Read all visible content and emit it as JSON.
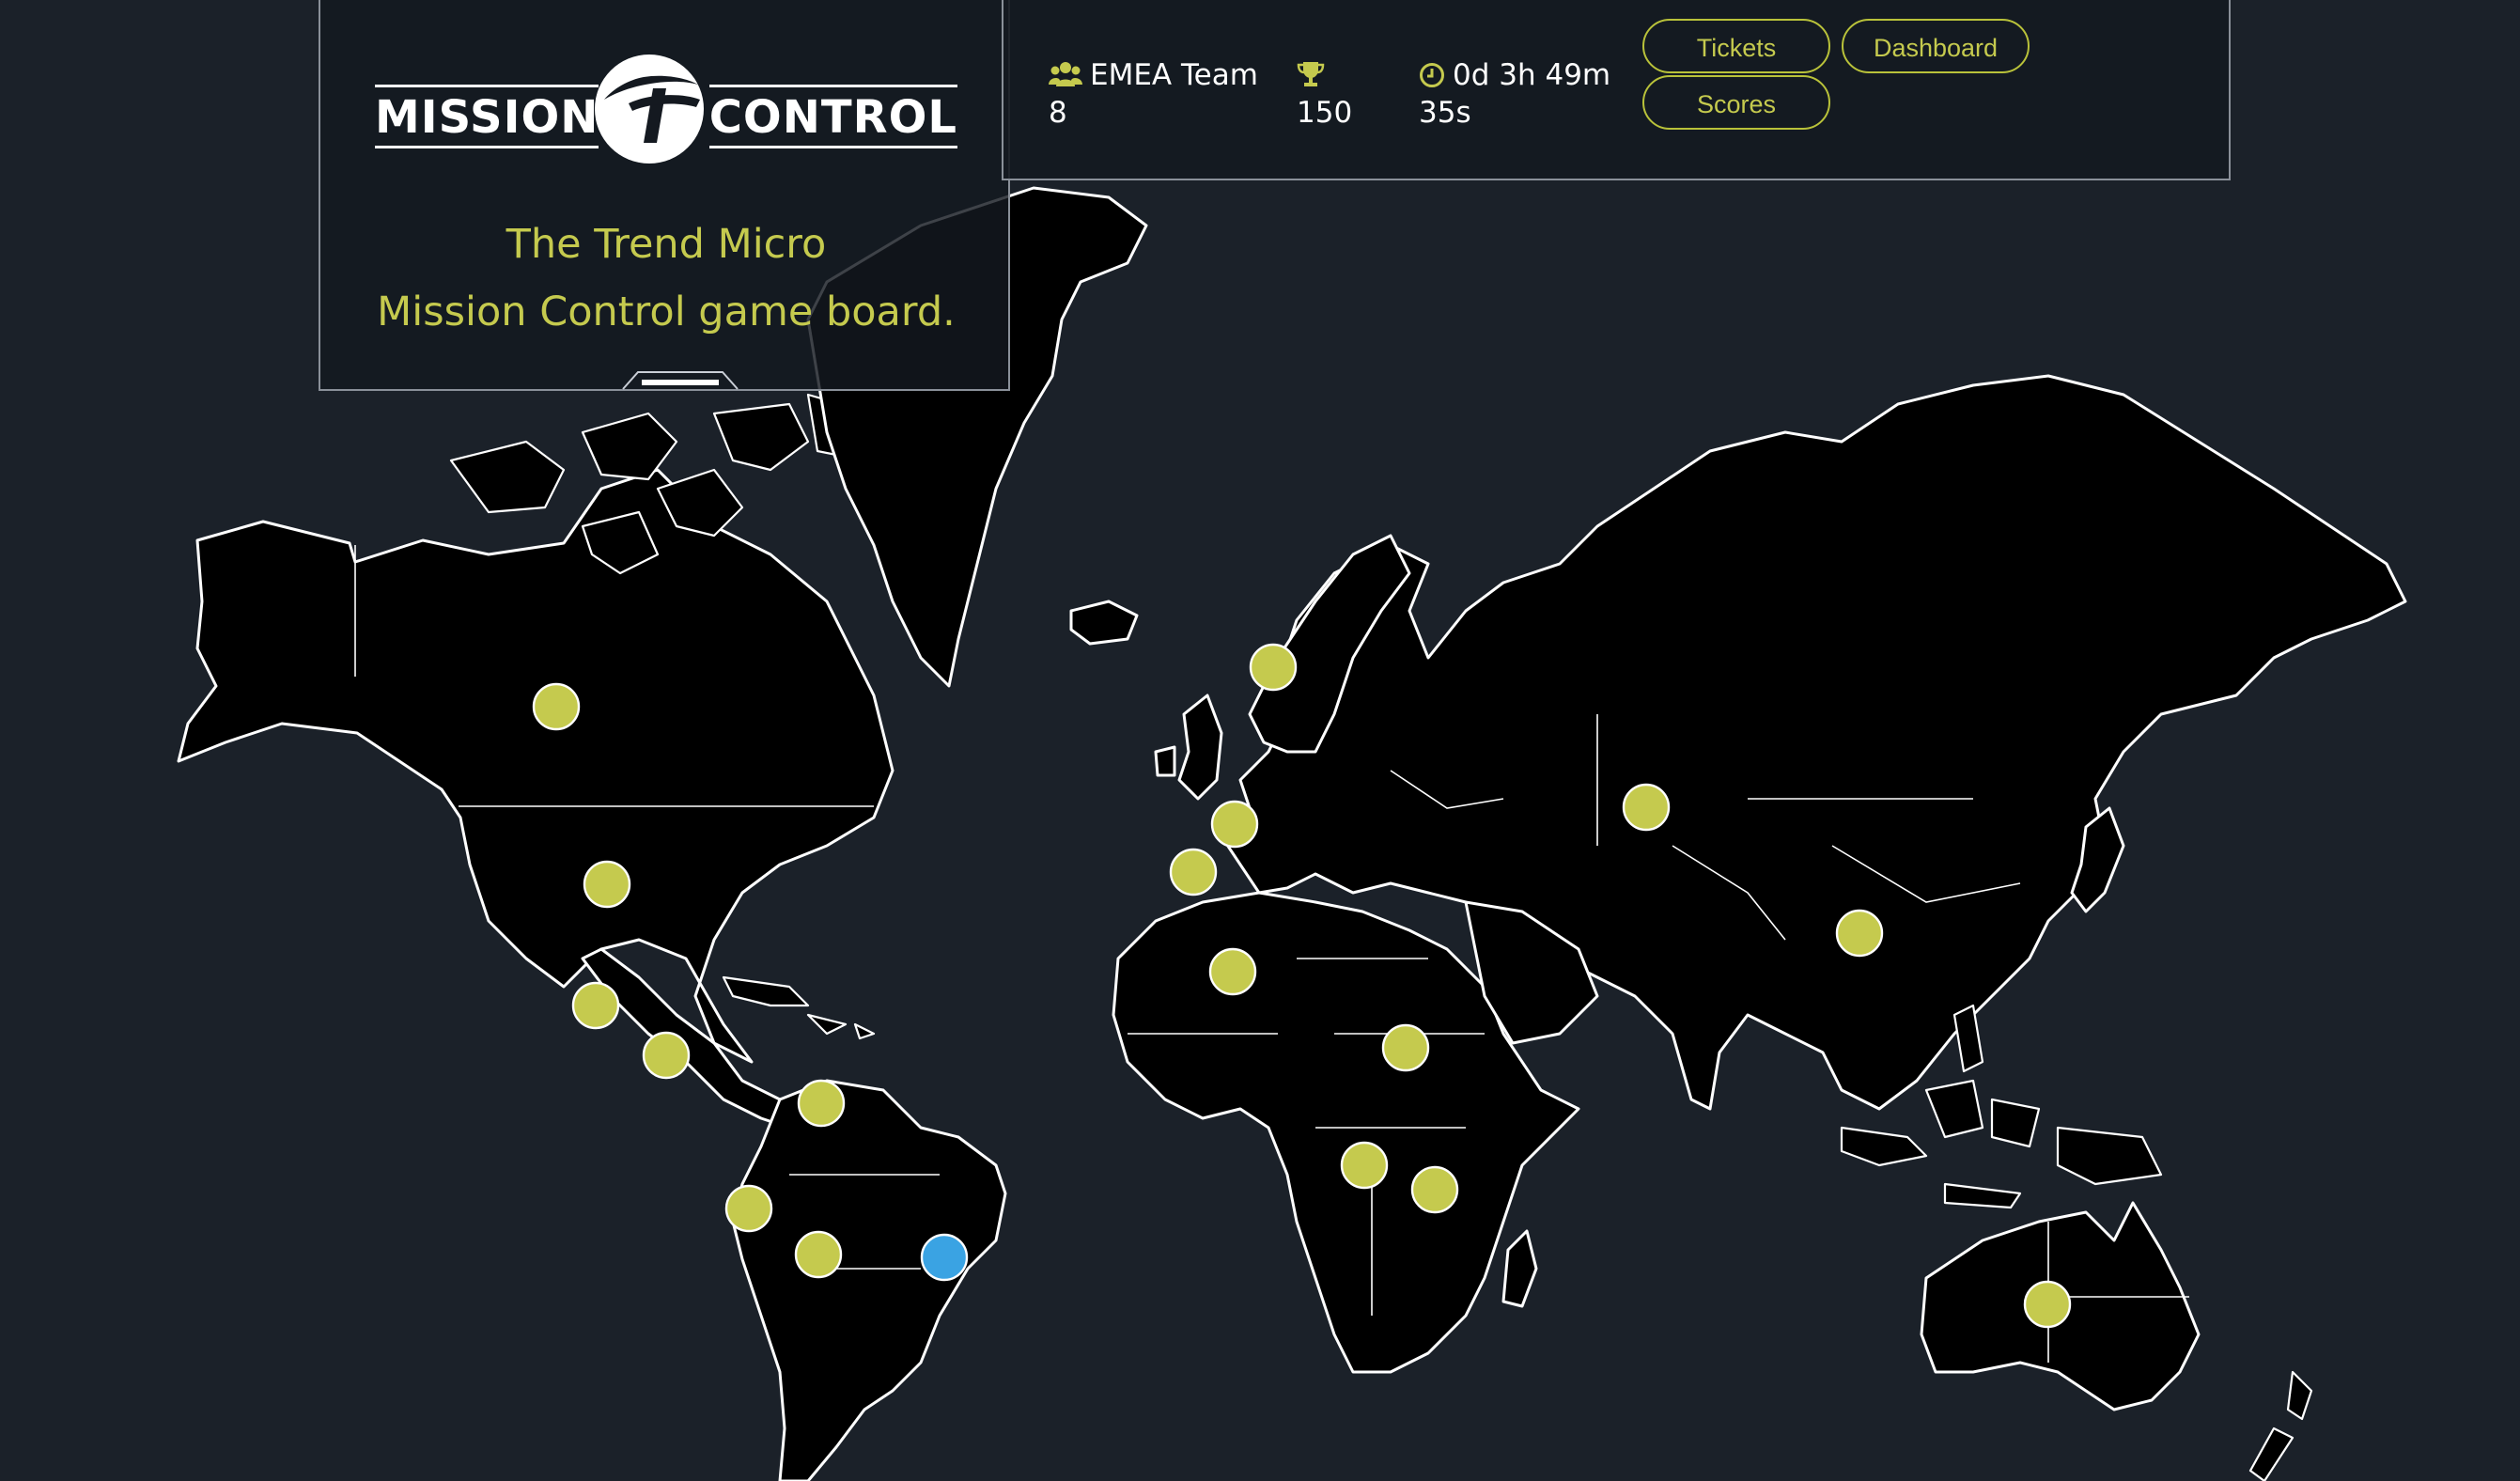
{
  "logo": {
    "word_left": "MISSION",
    "word_right": "CONTROL",
    "emblem": "trend-micro-t-ball-logo"
  },
  "tagline": {
    "line1": "The Trend Micro",
    "line2": "Mission Control game board."
  },
  "status": {
    "team_name": "EMEA Team",
    "team_count": "8",
    "score": "150",
    "timer_main": "0d 3h 49m",
    "timer_seconds": "35s",
    "icons": {
      "team": "users-icon",
      "score": "trophy-icon",
      "timer": "clock-icon"
    }
  },
  "nav": {
    "tickets_label": "Tickets",
    "dashboard_label": "Dashboard",
    "scores_label": "Scores"
  },
  "colors": {
    "background": "#1b2129",
    "land": "#000000",
    "outline": "#ffffff",
    "accent": "#c5ca4e",
    "marker_default": "#c5ca4e",
    "marker_active": "#3aa3e3"
  },
  "map": {
    "markers": [
      {
        "region": "Canada",
        "status": "default"
      },
      {
        "region": "United States",
        "status": "default"
      },
      {
        "region": "Mexico",
        "status": "default"
      },
      {
        "region": "Central America",
        "status": "default"
      },
      {
        "region": "Colombia / Venezuela",
        "status": "default"
      },
      {
        "region": "Peru",
        "status": "default"
      },
      {
        "region": "Bolivia",
        "status": "default"
      },
      {
        "region": "Brazil",
        "status": "active"
      },
      {
        "region": "Norway",
        "status": "default"
      },
      {
        "region": "France",
        "status": "default"
      },
      {
        "region": "Iberia",
        "status": "default"
      },
      {
        "region": "North-West Africa",
        "status": "default"
      },
      {
        "region": "Sudan",
        "status": "default"
      },
      {
        "region": "Central Africa",
        "status": "default"
      },
      {
        "region": "East Africa",
        "status": "default"
      },
      {
        "region": "Kazakhstan",
        "status": "default"
      },
      {
        "region": "China",
        "status": "default"
      },
      {
        "region": "Australia",
        "status": "default"
      }
    ]
  }
}
